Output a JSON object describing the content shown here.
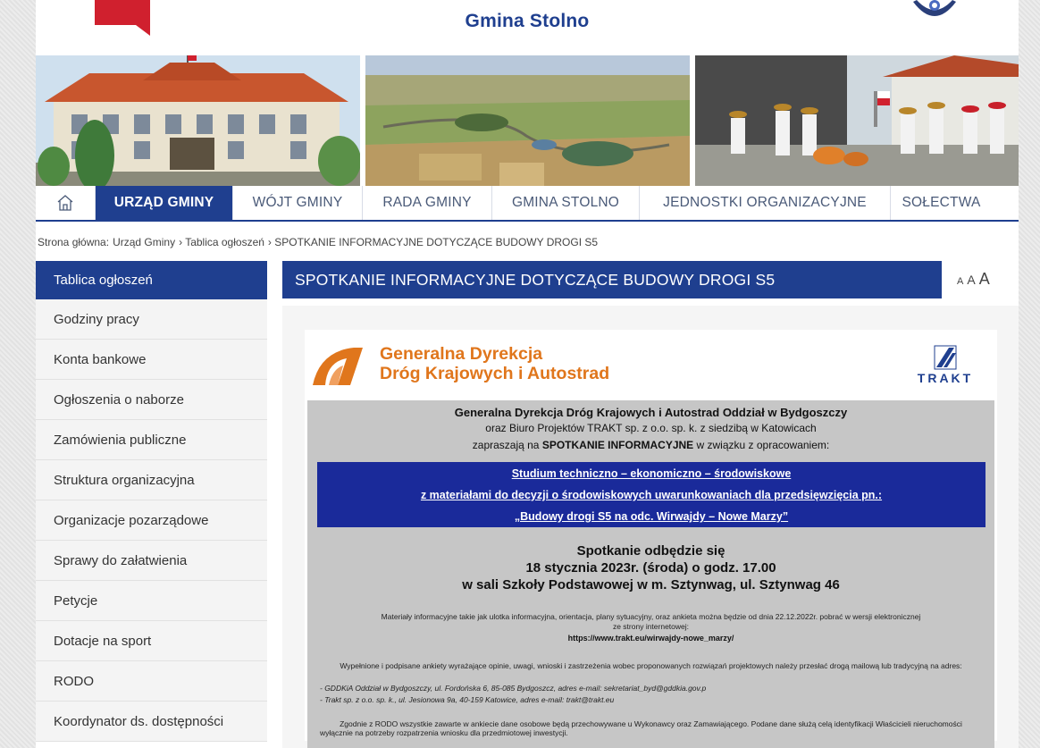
{
  "header": {
    "site_title": "Gmina Stolno",
    "colors": {
      "primary": "#1f3f8f",
      "accent": "#d0202e"
    }
  },
  "nav": {
    "items": [
      {
        "label": "URZĄD GMINY",
        "active": true
      },
      {
        "label": "WÓJT GMINY"
      },
      {
        "label": "RADA GMINY"
      },
      {
        "label": "GMINA STOLNO"
      },
      {
        "label": "JEDNOSTKI ORGANIZACYJNE"
      },
      {
        "label": "SOŁECTWA"
      }
    ]
  },
  "breadcrumb": {
    "home": "Strona główna:",
    "level1": "Urząd Gminy",
    "level2": "› Tablica ogłoszeń",
    "level3": "› SPOTKANIE INFORMACYJNE DOTYCZĄCE BUDOWY DROGI S5"
  },
  "sidebar": {
    "items": [
      {
        "label": "Tablica ogłoszeń",
        "active": true
      },
      {
        "label": "Godziny pracy"
      },
      {
        "label": "Konta bankowe"
      },
      {
        "label": "Ogłoszenia o naborze"
      },
      {
        "label": "Zamówienia publiczne"
      },
      {
        "label": "Struktura organizacyjna"
      },
      {
        "label": "Organizacje pozarządowe"
      },
      {
        "label": "Sprawy do załatwienia"
      },
      {
        "label": "Petycje"
      },
      {
        "label": "Dotacje na sport"
      },
      {
        "label": "RODO"
      },
      {
        "label": "Koordynator ds. dostępności"
      }
    ]
  },
  "main": {
    "title": "SPOTKANIE INFORMACYJNE DOTYCZĄCE BUDOWY DROGI S5",
    "font_size_labels": [
      "A",
      "A",
      "A"
    ],
    "notice": {
      "gddkia_line1": "Generalna Dyrekcja",
      "gddkia_line2": "Dróg Krajowych i Autostrad",
      "trakt_label": "TRAKT",
      "intro1": "Generalna Dyrekcja Dróg Krajowych i Autostrad  Oddział w Bydgoszczy",
      "intro2": "oraz Biuro Projektów TRAKT sp. z o.o. sp. k. z siedzibą w Katowicach",
      "intro3_pre": "zapraszają na ",
      "intro3_bold": "SPOTKANIE INFORMACYJNE",
      "intro3_post": " w związku z opracowaniem:",
      "box1": "Studium techniczno – ekonomiczno – środowiskowe",
      "box2": "z materiałami do decyzji o środowiskowych uwarunkowaniach  dla przedsięwzięcia pn.:",
      "box3": "„Budowy drogi S5  na odc. Wirwajdy – Nowe Marzy”",
      "meet1": "Spotkanie odbędzie się",
      "meet2": "18 stycznia 2023r. (środa) o godz. 17.00",
      "meet3": "w sali Szkoły Podstawowej w m. Sztynwag, ul. Sztynwag 46",
      "mat1": "Materiały informacyjne takie jak ulotka informacyjna, orientacja, plany sytuacyjny, oraz ankieta można będzie od dnia 22.12.2022r. pobrać w wersji elektronicznej",
      "mat2": "ze strony internetowej:",
      "url": "https://www.trakt.eu/wirwajdy-nowe_marzy/",
      "send": "Wypełnione i podpisane ankiety wyrażające opinie, uwagi, wnioski i zastrzeżenia wobec proponowanych rozwiązań projektowych należy przesłać drogą mailową lub tradycyjną na adres:",
      "addr1": "- GDDKiA Oddział w Bydgoszczy, ul. Fordońska 6, 85-085 Bydgoszcz, adres e-mail: sekretariat_byd@gddkia.gov.p",
      "addr2": "- Trakt sp. z o.o. sp. k., ul. Jesionowa 9a, 40-159 Katowice, adres e-mail: trakt@trakt.eu",
      "rodo1": "Zgodnie z RODO wszystkie zawarte w ankiecie dane osobowe będą przechowywane u Wykonawcy oraz Zamawiającego. Podane dane służą celą identyfikacji Właścicieli nieruchomości",
      "rodo2": "wyłącznie na potrzeby rozpatrzenia wniosku dla przedmiotowej inwestycji."
    }
  }
}
